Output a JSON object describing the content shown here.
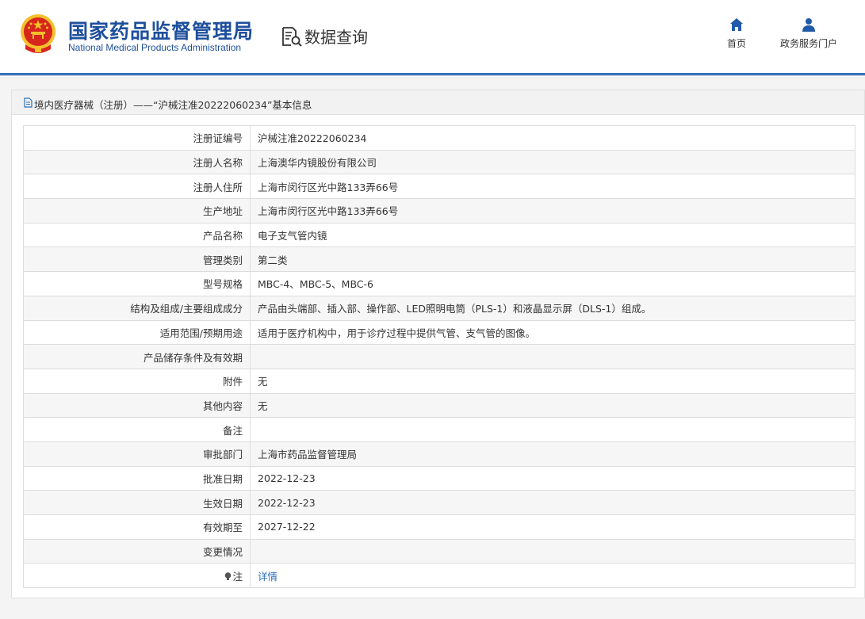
{
  "header": {
    "logo_cn": "国家药品监督管理局",
    "logo_en": "National Medical Products Administration",
    "section_title": "数据查询",
    "nav": [
      {
        "label": "首页",
        "icon": "home-icon"
      },
      {
        "label": "政务服务门户",
        "icon": "user-icon"
      }
    ]
  },
  "panel": {
    "title": "境内医疗器械（注册）——“沪械注准20222060234”基本信息"
  },
  "rows": [
    {
      "key": "注册证编号",
      "value": "沪械注准20222060234"
    },
    {
      "key": "注册人名称",
      "value": "上海澳华内镜股份有限公司"
    },
    {
      "key": "注册人住所",
      "value": "上海市闵行区光中路133弄66号"
    },
    {
      "key": "生产地址",
      "value": "上海市闵行区光中路133弄66号"
    },
    {
      "key": "产品名称",
      "value": "电子支气管内镜"
    },
    {
      "key": "管理类别",
      "value": "第二类"
    },
    {
      "key": "型号规格",
      "value": "MBC-4、MBC-5、MBC-6"
    },
    {
      "key": "结构及组成/主要组成成分",
      "value": "产品由头端部、插入部、操作部、LED照明电筒（PLS-1）和液晶显示屏（DLS-1）组成。"
    },
    {
      "key": "适用范围/预期用途",
      "value": "适用于医疗机构中，用于诊疗过程中提供气管、支气管的图像。"
    },
    {
      "key": "产品储存条件及有效期",
      "value": ""
    },
    {
      "key": "附件",
      "value": "无"
    },
    {
      "key": "其他内容",
      "value": "无"
    },
    {
      "key": "备注",
      "value": ""
    },
    {
      "key": "审批部门",
      "value": "上海市药品监督管理局"
    },
    {
      "key": "批准日期",
      "value": "2022-12-23"
    },
    {
      "key": "生效日期",
      "value": "2022-12-23"
    },
    {
      "key": "有效期至",
      "value": "2027-12-22"
    },
    {
      "key": "变更情况",
      "value": ""
    }
  ],
  "note_row": {
    "key": "注",
    "link": "详情",
    "icon": "bulb-icon"
  },
  "colors": {
    "brand_blue": "#1e4f9c",
    "link": "#2b70b8",
    "emblem_red": "#d7261e",
    "emblem_gold": "#f5c02a"
  }
}
